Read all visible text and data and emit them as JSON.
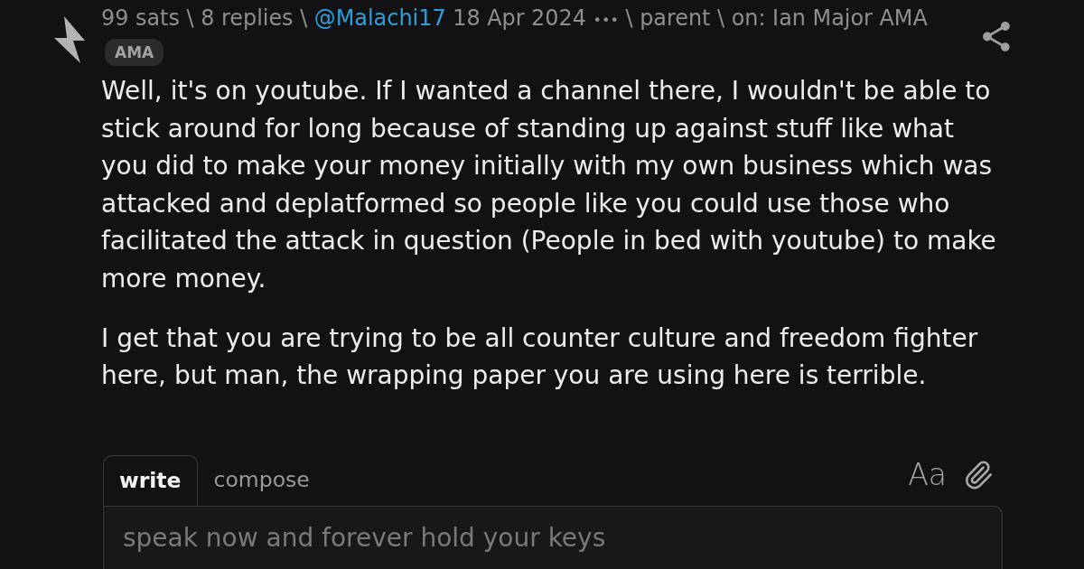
{
  "item": {
    "meta": [
      {
        "kind": "stat",
        "text": "99 sats"
      },
      {
        "kind": "separator",
        "text": "\\"
      },
      {
        "kind": "link",
        "text": "8 replies"
      },
      {
        "kind": "separator",
        "text": "\\"
      },
      {
        "kind": "author",
        "text": "@Malachi17"
      },
      {
        "kind": "date",
        "text": "18 Apr 2024"
      },
      {
        "kind": "menu",
        "text": "•••"
      },
      {
        "kind": "separator",
        "text": "\\"
      },
      {
        "kind": "link",
        "text": "parent"
      },
      {
        "kind": "separator",
        "text": "\\"
      },
      {
        "kind": "link",
        "text": "on: Ian Major AMA"
      }
    ],
    "badges": [
      {
        "label": "AMA"
      }
    ],
    "body": [
      "Well, it's on youtube. If I wanted a channel there, I wouldn't be able to stick around for long because of standing up against stuff like what you did to make your money initially with my own business which was attacked and deplatformed so people like you could use those who facilitated the attack in question (People in bed with youtube) to make more money.",
      "I get that you are trying to be all counter culture and freedom fighter here, but man, the wrapping paper you are using here is terrible."
    ]
  },
  "editor": {
    "tabs": [
      {
        "label": "write",
        "selected": true
      },
      {
        "label": "compose",
        "selected": false
      }
    ],
    "format_toggle": "Aa",
    "placeholder": "speak now and forever hold your keys"
  }
}
